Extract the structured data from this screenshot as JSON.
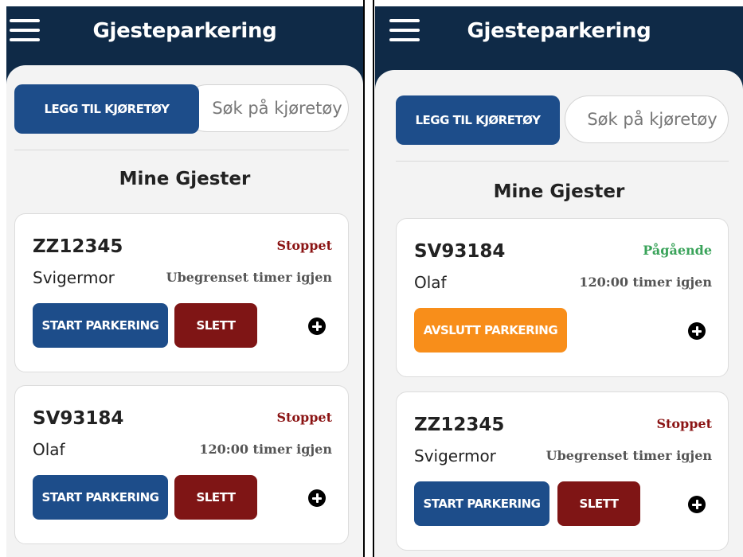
{
  "app": {
    "title": "Gjesteparkering"
  },
  "toolbar": {
    "add_vehicle_label": "LEGG TIL KJØRETØY",
    "search_placeholder": "Søk på kjøretøy"
  },
  "section_title": "Mine Gjester",
  "icons": {
    "menu": "hamburger-menu-icon",
    "add": "plus-circle-icon"
  },
  "colors": {
    "header": "#0f2a47",
    "primary_button": "#1d4d8a",
    "delete_button": "#7f1515",
    "end_button": "#f88e1a",
    "status_stopped": "#8b1414",
    "status_ongoing": "#3aa35a"
  },
  "screens": [
    {
      "guests": [
        {
          "plate": "ZZ12345",
          "status": "Stoppet",
          "name": "Svigermor",
          "time_left": "Ubegrenset timer igjen",
          "start_label": "START PARKERING",
          "delete_label": "SLETT"
        },
        {
          "plate": "SV93184",
          "status": "Stoppet",
          "name": "Olaf",
          "time_left": "120:00 timer igjen",
          "start_label": "START PARKERING",
          "delete_label": "SLETT"
        }
      ]
    },
    {
      "guests": [
        {
          "plate": "SV93184",
          "status": "Pågående",
          "name": "Olaf",
          "time_left": "120:00 timer igjen",
          "end_label": "AVSLUTT PARKERING"
        },
        {
          "plate": "ZZ12345",
          "status": "Stoppet",
          "name": "Svigermor",
          "time_left": "Ubegrenset timer igjen",
          "start_label": "START PARKERING",
          "delete_label": "SLETT"
        }
      ]
    }
  ]
}
